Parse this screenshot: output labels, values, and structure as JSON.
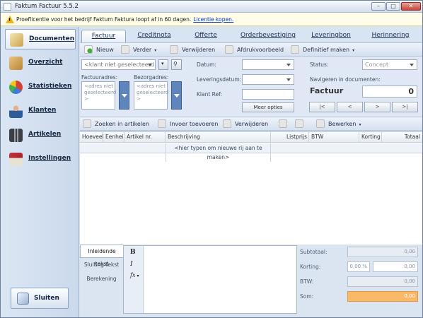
{
  "window": {
    "title": "Faktum Factuur 5.5.2",
    "min": "–",
    "max": "□",
    "close": "✕"
  },
  "banner": {
    "message": "Proeflicentie voor het bedrijf Faktum Faktura loopt af in 60 dagen.",
    "link": "Licentie kopen."
  },
  "sidebar": {
    "items": [
      {
        "label": "Documenten",
        "icon": "documents-icon",
        "color": "#c9a24b"
      },
      {
        "label": "Overzicht",
        "icon": "overview-icon",
        "color": "#b8863b"
      },
      {
        "label": "Statistieken",
        "icon": "statistics-icon",
        "color": "#d2423a"
      },
      {
        "label": "Klanten",
        "icon": "customers-icon",
        "color": "#2f5b9a"
      },
      {
        "label": "Artikelen",
        "icon": "articles-icon",
        "color": "#3a3f4a"
      },
      {
        "label": "Instellingen",
        "icon": "settings-icon",
        "color": "#c7343c"
      }
    ],
    "close": "Sluiten"
  },
  "tabs": [
    "Factuur",
    "Creditnota",
    "Offerte",
    "Orderbevestiging",
    "Leveringbon",
    "Herinnering"
  ],
  "toolbar1": {
    "new": "Nieuw",
    "next": "Verder",
    "delete": "Verwijderen",
    "preview": "Afdrukvoorbeeld",
    "final": "Definitief maken"
  },
  "form": {
    "customer_placeholder": "<klant niet geselecteerd",
    "invoice_address_label": "Factuuradres:",
    "delivery_address_label": "Bezorgadres:",
    "address_placeholder": "<adres niet geselecteerd >",
    "date_label": "Datum:",
    "delivery_date_label": "Leveringsdatum:",
    "customer_ref_label": "Klant Ref:",
    "more_options": "Meer opties",
    "status_label": "Status:",
    "status_value": "Concept",
    "navigate_label": "Navigeren in documenten:",
    "doc_type": "Factuur",
    "doc_number": "0",
    "nav_first": "|<",
    "nav_prev": "<",
    "nav_next": ">",
    "nav_last": ">|"
  },
  "toolbar2": {
    "search": "Zoeken in artikelen",
    "insert": "Invoer toevoeren",
    "delete": "Verwijderen",
    "edit": "Bewerken"
  },
  "grid": {
    "columns": [
      "Hoeveel",
      "Eenhei",
      "Artikel nr.",
      "Beschrijving",
      "Listprijs",
      "BTW",
      "Korting",
      "Totaal"
    ],
    "new_row": "<hier typen om nieuwe rij aan te maken>"
  },
  "bottom": {
    "tabs": [
      "Inleidende tekst",
      "Sluiting tekst",
      "Berekening"
    ],
    "tools": {
      "bold": "B",
      "italic": "I",
      "fx": "fx"
    },
    "totals": {
      "subtotal_label": "Subtotaal:",
      "subtotal": "0,00",
      "discount_label": "Korting:",
      "discount_pct": "0,00 %",
      "discount": "0,00",
      "vat_label": "BTW:",
      "vat": "0,00",
      "sum_label": "Som:",
      "sum": "0,00"
    }
  }
}
